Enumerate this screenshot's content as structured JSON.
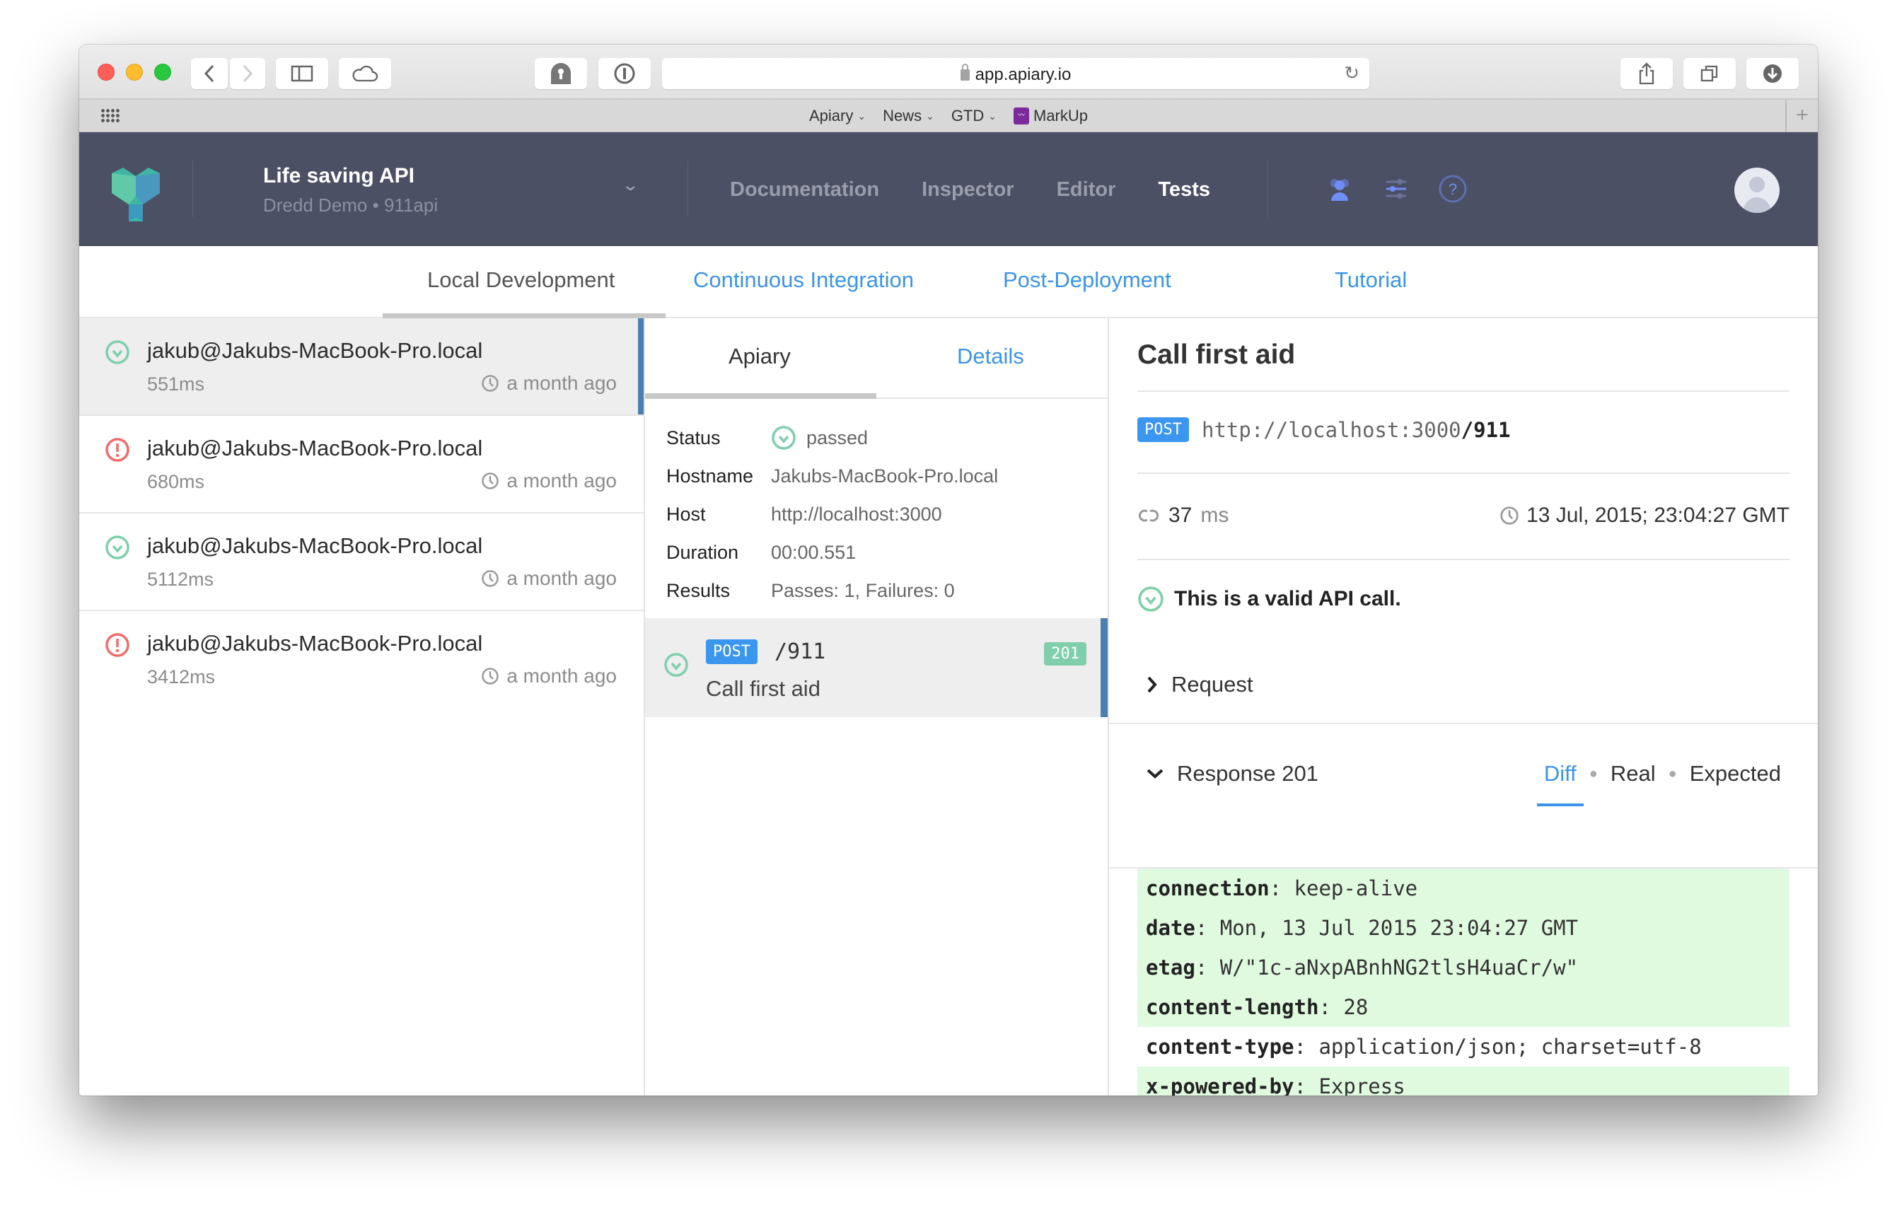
{
  "browser": {
    "url": "app.apiary.io",
    "bookmarks": [
      {
        "label": "Apiary",
        "has_menu": true
      },
      {
        "label": "News",
        "has_menu": true
      },
      {
        "label": "GTD",
        "has_menu": true
      },
      {
        "label": "MarkUp",
        "has_menu": false
      }
    ]
  },
  "header": {
    "project_name": "Life saving API",
    "project_sub": "Dredd Demo • 911api",
    "nav": [
      {
        "label": "Documentation",
        "active": false
      },
      {
        "label": "Inspector",
        "active": false
      },
      {
        "label": "Editor",
        "active": false
      },
      {
        "label": "Tests",
        "active": true
      }
    ],
    "icons": [
      "team-icon",
      "settings-sliders-icon",
      "help-icon"
    ],
    "colors": {
      "header_bg": "#4b5064",
      "icon_accent": "#6f8ef7"
    }
  },
  "tabs": [
    {
      "label": "Local Development",
      "active": true
    },
    {
      "label": "Continuous Integration",
      "active": false
    },
    {
      "label": "Post-Deployment",
      "active": false
    },
    {
      "label": "Tutorial",
      "active": false
    }
  ],
  "runs": [
    {
      "title": "jakub@Jakubs-MacBook-Pro.local",
      "duration": "551ms",
      "time": "a month ago",
      "status": "passed",
      "selected": true
    },
    {
      "title": "jakub@Jakubs-MacBook-Pro.local",
      "duration": "680ms",
      "time": "a month ago",
      "status": "failed",
      "selected": false
    },
    {
      "title": "jakub@Jakubs-MacBook-Pro.local",
      "duration": "5112ms",
      "time": "a month ago",
      "status": "passed",
      "selected": false
    },
    {
      "title": "jakub@Jakubs-MacBook-Pro.local",
      "duration": "3412ms",
      "time": "a month ago",
      "status": "failed",
      "selected": false
    }
  ],
  "run_detail": {
    "subtabs": [
      {
        "label": "Apiary",
        "active": true
      },
      {
        "label": "Details",
        "active": false
      }
    ],
    "info": [
      {
        "label": "Status",
        "value": "passed"
      },
      {
        "label": "Hostname",
        "value": "Jakubs-MacBook-Pro.local"
      },
      {
        "label": "Host",
        "value": "http://localhost:3000"
      },
      {
        "label": "Duration",
        "value": "00:00.551"
      },
      {
        "label": "Results",
        "value": "Passes: 1, Failures: 0"
      }
    ],
    "transaction": {
      "method": "POST",
      "path": "/911",
      "name": "Call first aid",
      "status_code": "201"
    }
  },
  "transaction_detail": {
    "title": "Call first aid",
    "method": "POST",
    "url_base": "http://localhost:3000",
    "url_path": "/911",
    "latency_value": "37",
    "latency_unit": "ms",
    "timestamp": "13 Jul, 2015; 23:04:27 GMT",
    "validity": "This is a valid API call.",
    "request_label": "Request",
    "response_label": "Response 201",
    "views": [
      {
        "label": "Diff",
        "active": true
      },
      {
        "label": "Real",
        "active": false
      },
      {
        "label": "Expected",
        "active": false
      }
    ],
    "headers": [
      {
        "name": "connection",
        "value": "keep-alive",
        "added": true
      },
      {
        "name": "date",
        "value": "Mon, 13 Jul 2015 23:04:27 GMT",
        "added": true
      },
      {
        "name": "etag",
        "value": "W/\"1c-aNxpABnhNG2tlsH4uaCr/w\"",
        "added": true
      },
      {
        "name": "content-length",
        "value": "28",
        "added": true
      },
      {
        "name": "content-type",
        "value": "application/json; charset=utf-8",
        "added": false
      },
      {
        "name": "x-powered-by",
        "value": "Express",
        "added": true
      }
    ],
    "body_start": "{"
  },
  "colors": {
    "link_blue": "#3b94e8",
    "pass_green": "#7fcfab",
    "fail_red": "#f26b6b",
    "post_blue": "#3b96f0",
    "diff_added_bg": "#e0fae0",
    "selection_bar": "#4a7fb0"
  }
}
